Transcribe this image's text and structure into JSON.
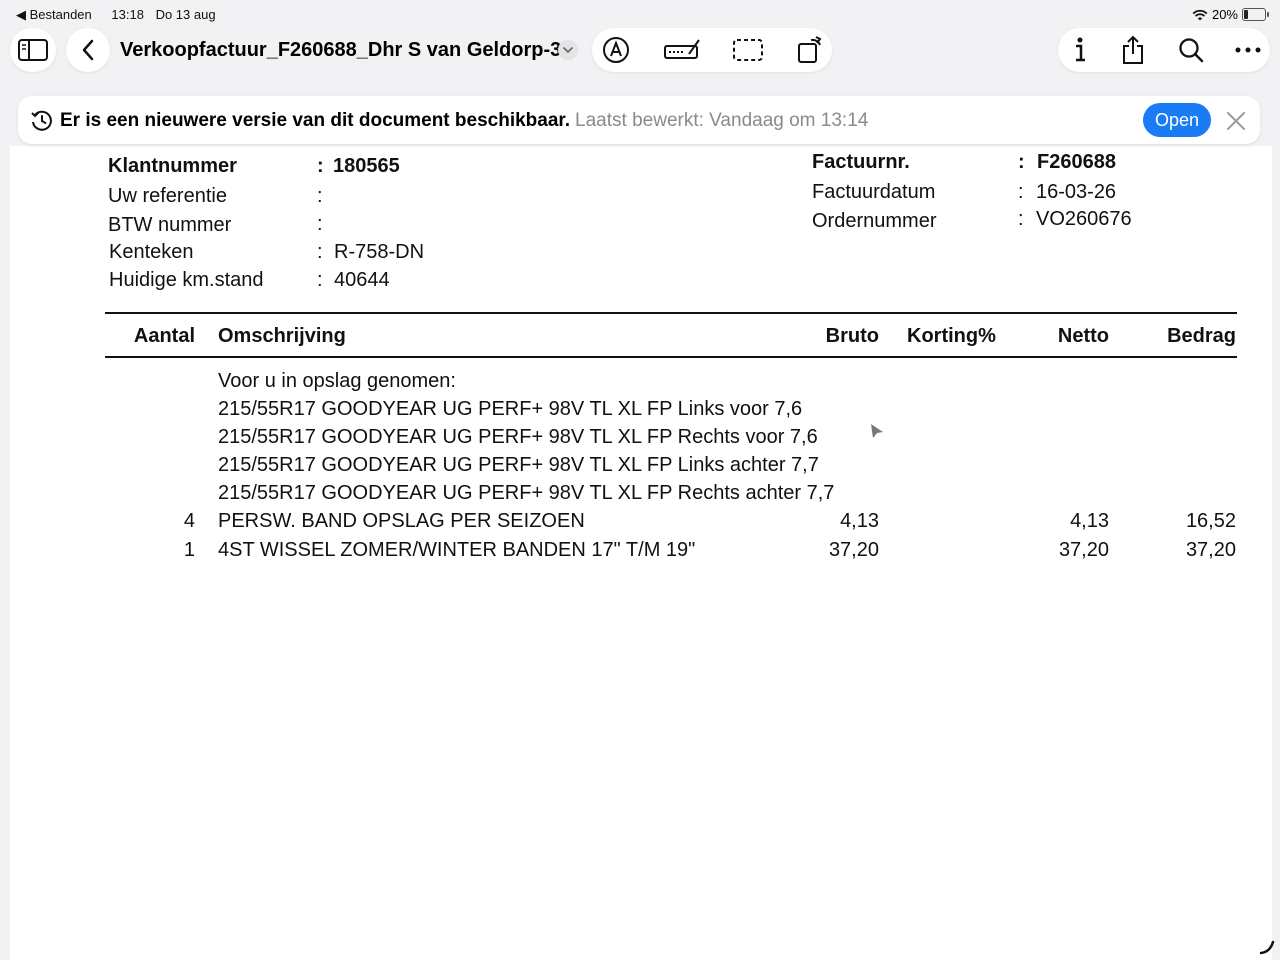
{
  "status_bar": {
    "back_app": "Bestanden",
    "time": "13:18",
    "date": "Do 13 aug",
    "battery": "20%"
  },
  "toolbar": {
    "document_title": "Verkoopfactuur_F260688_Dhr S van Geldorp-3"
  },
  "banner": {
    "message": "Er is een nieuwere versie van dit document beschikbaar.",
    "last_edited": "Laatst bewerkt: Vandaag om 13:14",
    "open_label": "Open"
  },
  "invoice": {
    "left_fields": [
      {
        "label": "Klantnummer",
        "value": "180565"
      },
      {
        "label": "Uw referentie",
        "value": ""
      },
      {
        "label": "BTW nummer",
        "value": ""
      },
      {
        "label": "Kenteken",
        "value": "R-758-DN"
      },
      {
        "label": "Huidige km.stand",
        "value": "40644"
      }
    ],
    "right_fields": [
      {
        "label": "Factuurnr.",
        "value": "F260688"
      },
      {
        "label": "Factuurdatum",
        "value": "16-03-26"
      },
      {
        "label": "Ordernummer",
        "value": "VO260676"
      }
    ],
    "separator": ":",
    "columns": {
      "aantal": "Aantal",
      "omschrijving": "Omschrijving",
      "bruto": "Bruto",
      "korting": "Korting%",
      "netto": "Netto",
      "bedrag": "Bedrag"
    },
    "notes": [
      "Voor u in opslag genomen:",
      "215/55R17 GOODYEAR UG PERF+ 98V TL XL FP Links voor 7,6",
      "215/55R17 GOODYEAR UG PERF+ 98V TL XL FP Rechts voor 7,6",
      "215/55R17 GOODYEAR UG PERF+ 98V TL XL FP Links achter 7,7",
      "215/55R17 GOODYEAR UG PERF+ 98V TL XL FP Rechts achter 7,7"
    ],
    "lines": [
      {
        "aantal": "4",
        "omschrijving": "PERSW. BAND OPSLAG PER SEIZOEN",
        "bruto": "4,13",
        "korting": "",
        "netto": "4,13",
        "bedrag": "16,52"
      },
      {
        "aantal": "1",
        "omschrijving": "4ST WISSEL ZOMER/WINTER BANDEN 17\" T/M 19\"",
        "bruto": "37,20",
        "korting": "",
        "netto": "37,20",
        "bedrag": "37,20"
      }
    ]
  }
}
